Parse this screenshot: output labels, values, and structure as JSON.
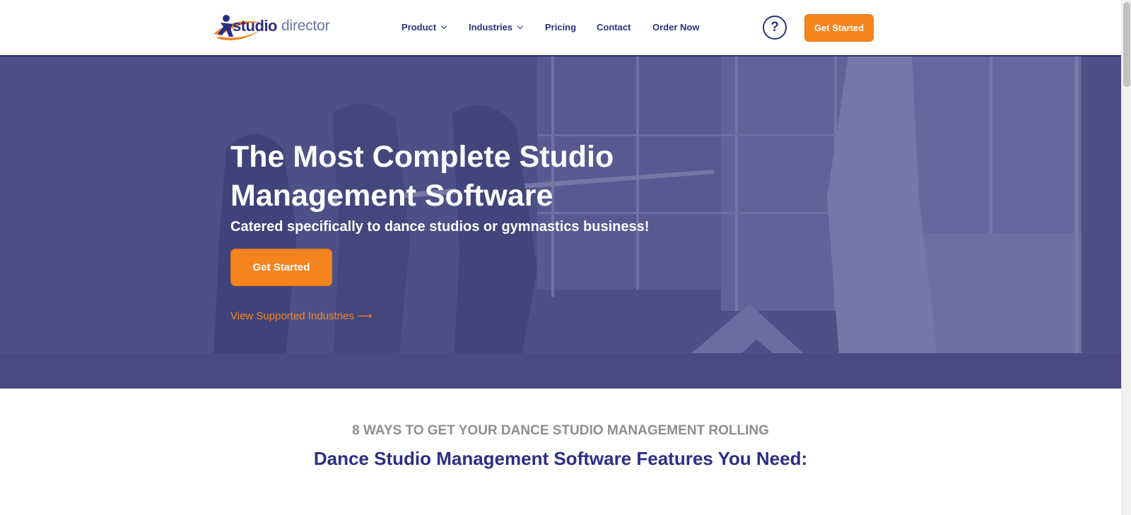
{
  "header": {
    "logo": {
      "word1": "studio",
      "word2": "director"
    },
    "nav": [
      {
        "label": "Product"
      },
      {
        "label": "Industries"
      },
      {
        "label": "Pricing"
      },
      {
        "label": "Contact"
      },
      {
        "label": "Order Now"
      }
    ],
    "help_label": "?",
    "cta_label": "Get Started"
  },
  "hero": {
    "title": "The Most Complete Studio Management Software",
    "subtitle": "Catered specifically to dance studios or gymnastics business!",
    "cta_label": "Get Started",
    "link_label": "View Supported Industries ⟶"
  },
  "features": {
    "eyebrow": "8 WAYS TO GET YOUR DANCE STUDIO MANAGEMENT ROLLING",
    "title": "Dance Studio Management Software Features You Need:"
  },
  "colors": {
    "brand_navy": "#2b3177",
    "brand_orange": "#f5841f",
    "hero_overlay": "#4d5088"
  }
}
